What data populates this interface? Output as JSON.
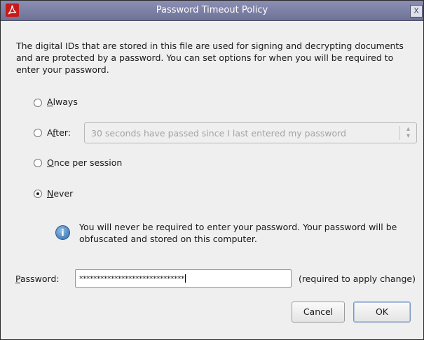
{
  "window": {
    "title": "Password Timeout Policy",
    "close_glyph": "X",
    "icon": "acrobat-icon"
  },
  "description": "The digital IDs that are stored in this file are used for signing and decrypting documents and are protected by a password. You can set options for when you will be required to enter your password.",
  "options": {
    "always": {
      "mnemonic": "A",
      "rest": "lways",
      "selected": false
    },
    "after": {
      "pre": "A",
      "mnemonic": "f",
      "rest": "ter:",
      "selected": false
    },
    "once": {
      "mnemonic": "O",
      "rest": "nce per session",
      "selected": false
    },
    "never": {
      "mnemonic": "N",
      "rest": "ever",
      "selected": true
    }
  },
  "after_select": {
    "value": "30 seconds have passed since I last entered my password",
    "disabled": true
  },
  "info": {
    "icon": "info-icon",
    "text": "You will never be required to enter your password. Your password will be obfuscated and stored on this computer."
  },
  "password": {
    "label_mnemonic": "P",
    "label_rest": "assword:",
    "value": "******************************",
    "hint": "(required to apply change)"
  },
  "buttons": {
    "cancel": "Cancel",
    "ok": "OK"
  },
  "colors": {
    "titlebar": "#7c80a5",
    "window_bg": "#efefef",
    "info_icon": "#2f6aa8",
    "ok_border": "#7a96c2"
  }
}
